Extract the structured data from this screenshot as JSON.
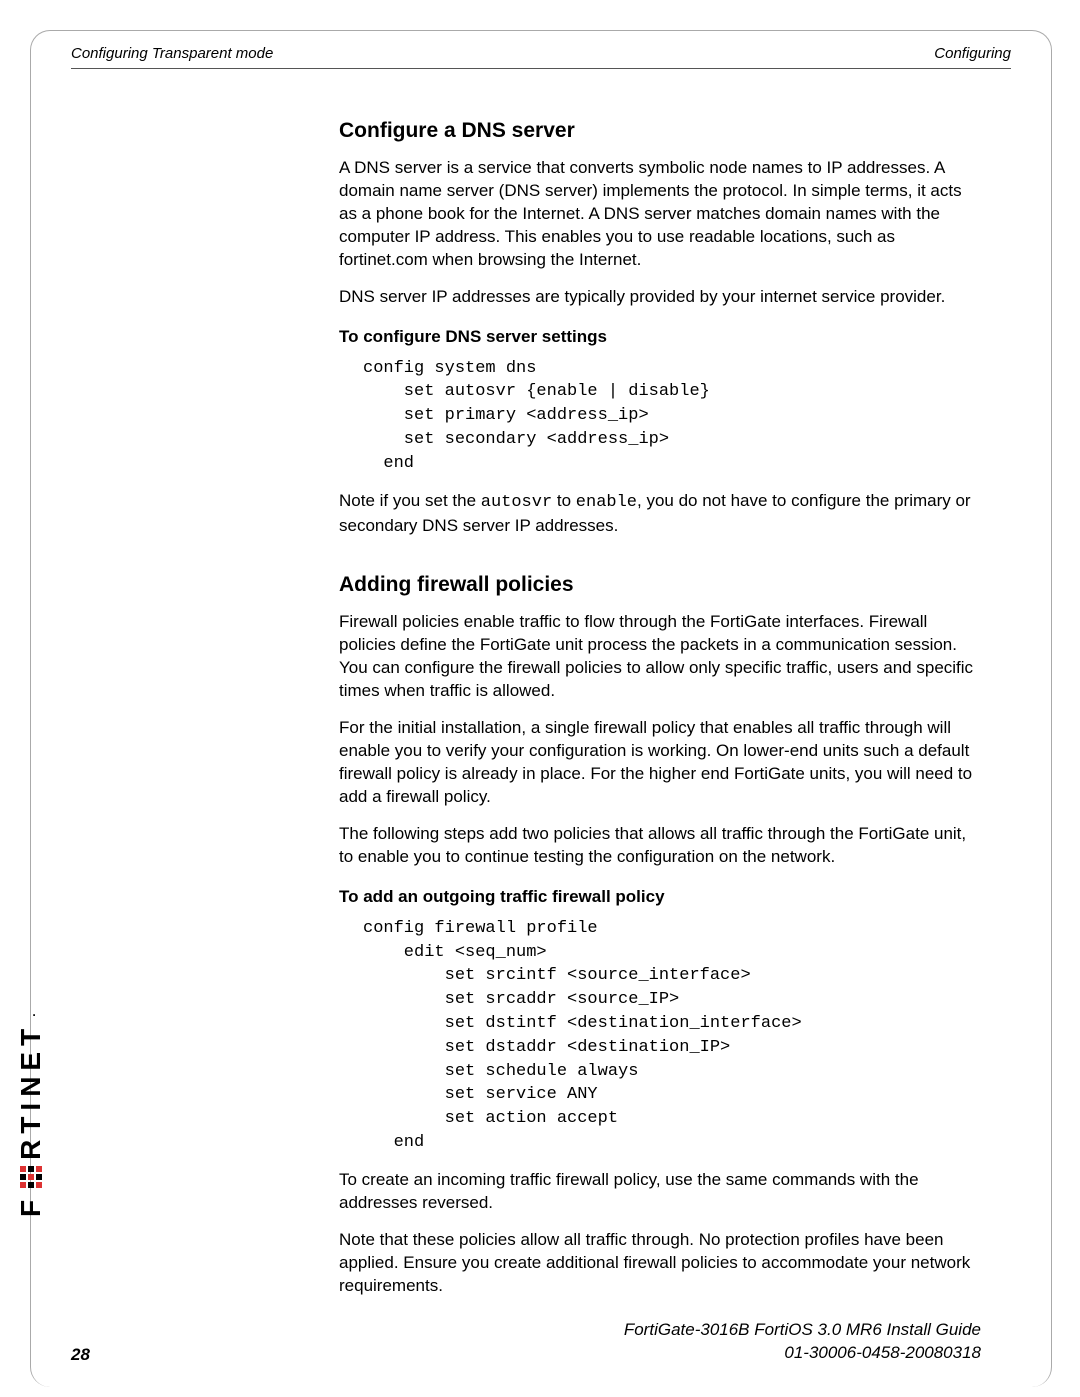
{
  "header": {
    "left": "Configuring Transparent mode",
    "right": "Configuring"
  },
  "section1": {
    "title": "Configure a DNS server",
    "p1": "A DNS server is a service that converts symbolic node names to IP addresses. A domain name server (DNS server) implements the protocol. In simple terms, it acts as a phone book for the Internet. A DNS server matches domain names with the computer IP address. This enables you to use readable locations, such as fortinet.com when browsing the Internet.",
    "p2": "DNS server IP addresses are typically provided by your internet service provider.",
    "sub1": "To configure DNS server settings",
    "code1": "config system dns\n    set autosvr {enable | disable}\n    set primary <address_ip>\n    set secondary <address_ip>\n  end",
    "note1_pre": "Note if you set the ",
    "note1_c1": "autosvr",
    "note1_mid": " to ",
    "note1_c2": "enable",
    "note1_post": ", you do not have to configure the primary or secondary DNS server IP addresses."
  },
  "section2": {
    "title": "Adding firewall policies",
    "p1": "Firewall policies enable traffic to flow through the FortiGate interfaces. Firewall policies define the FortiGate unit process the packets in a communication session. You can configure the firewall policies to allow only specific traffic, users and specific times when traffic is allowed.",
    "p2": "For the initial installation, a single firewall policy that enables all traffic through will enable you to verify your configuration is working. On lower-end units such a default firewall policy is already in place. For the higher end FortiGate units, you will need to add a firewall policy.",
    "p3": "The following steps add two policies that allows all traffic through the FortiGate unit, to enable you to continue testing the configuration on the network.",
    "sub1": "To add an outgoing traffic firewall policy",
    "code1": "config firewall profile\n    edit <seq_num>\n        set srcintf <source_interface>\n        set srcaddr <source_IP>\n        set dstintf <destination_interface>\n        set dstaddr <destination_IP>\n        set schedule always\n        set service ANY\n        set action accept\n   end",
    "p4": "To create an incoming traffic firewall policy, use the same commands with the addresses reversed.",
    "p5": "Note that these policies allow all traffic through. No protection profiles have been applied. Ensure you create additional firewall policies to accommodate your network requirements."
  },
  "footer": {
    "page": "28",
    "line1": "FortiGate-3016B FortiOS 3.0 MR6 Install Guide",
    "line2": "01-30006-0458-20080318"
  },
  "logo": {
    "text": "RTINET",
    "suffix": "."
  }
}
